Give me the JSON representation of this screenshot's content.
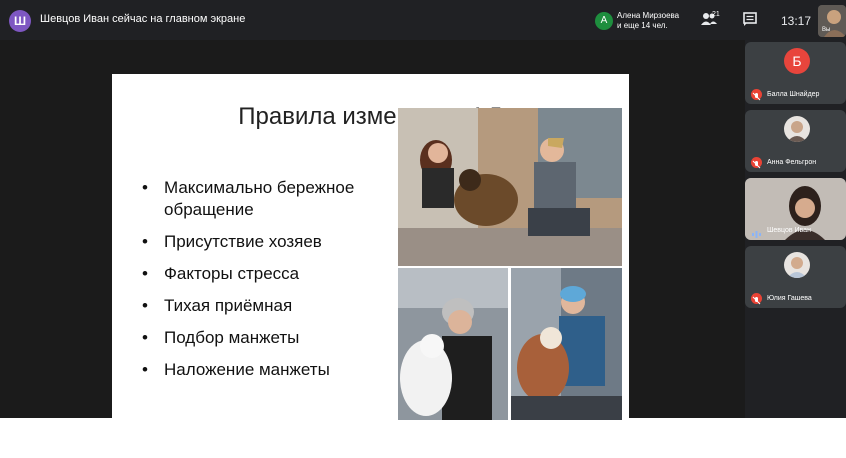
{
  "topbar": {
    "presenter_initial": "Ш",
    "presenter_text": "Шевцов Иван сейчас на главном экране",
    "participants": {
      "initial": "А",
      "name": "Алена Мирзоева",
      "more": "и еще 14 чел."
    },
    "people_count": "21",
    "time": "13:17",
    "self_label": "Вы"
  },
  "slide": {
    "title": "Правила измерения АД",
    "bullets": [
      "Максимально бережное обращение",
      "Присутствие хозяев",
      "Факторы стресса",
      "Тихая приёмная",
      "Подбор манжеты",
      "Наложение манжеты"
    ]
  },
  "tiles": [
    {
      "initial": "Б",
      "name": "Балла Шнайдер",
      "avatar_color": "#e8453c",
      "muted": true
    },
    {
      "initial": "",
      "name": "Анна Фельгрон",
      "muted": true
    },
    {
      "initial": "",
      "name": "Шевцов Иван",
      "muted": false
    },
    {
      "initial": "",
      "name": "Юлия Гашева",
      "muted": true
    }
  ],
  "colors": {
    "topbar": "#202124",
    "stage": "#1b1b1b",
    "tile": "#3c4043",
    "mic_off": "#ea4335",
    "speaking": "#1a73e8"
  }
}
